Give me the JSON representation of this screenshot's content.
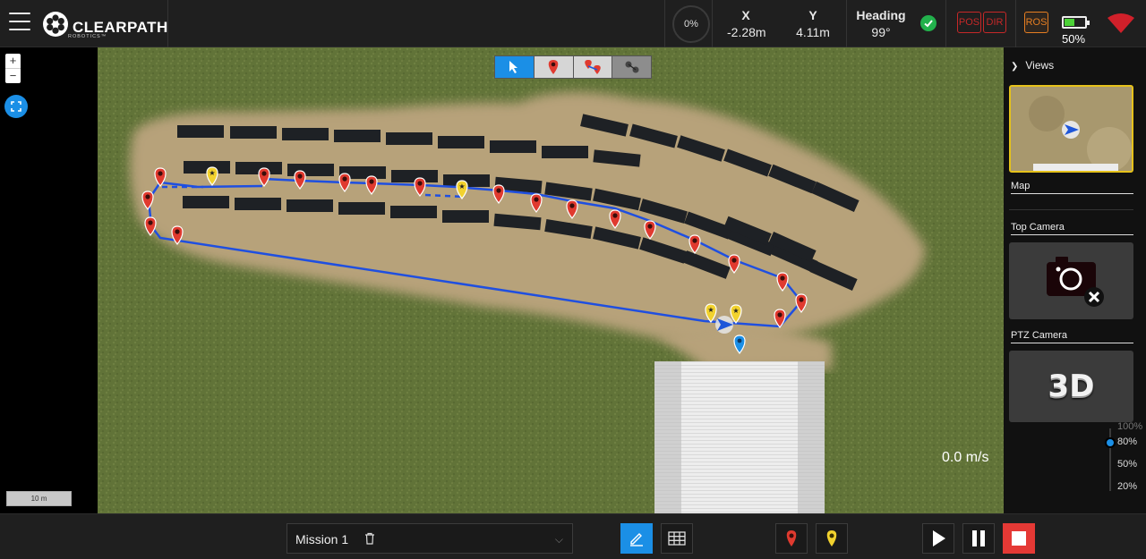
{
  "app": {
    "logo_text": "CLEARPATH",
    "logo_sub": "ROBOTICS™"
  },
  "status": {
    "progress_label": "0%",
    "x_label": "X",
    "x_value": "-2.28m",
    "y_label": "Y",
    "y_value": "4.11m",
    "heading_label": "Heading",
    "heading_value": "99°",
    "pos_badge": "POS",
    "dir_badge": "DIR",
    "ros_badge": "ROS",
    "battery_pct": "50%",
    "battery_level": 0.5,
    "colors": {
      "ok": "#22b14c",
      "error": "#c62828",
      "warn": "#e67e22",
      "accent": "#1b8fe6"
    }
  },
  "map": {
    "zoom_in": "+",
    "zoom_out": "−",
    "scale_label": "10 m",
    "speed": "0.0 m/s",
    "toolbar_icons": [
      "cursor-icon",
      "waypoint-icon",
      "route-icon",
      "cluster-icon"
    ]
  },
  "views": {
    "header": "Views",
    "items": [
      {
        "label": "Map"
      },
      {
        "label": "Top Camera"
      },
      {
        "label": "PTZ Camera",
        "thumb_text": "3D"
      }
    ]
  },
  "speed_slider": {
    "labels": [
      "100%",
      "80%",
      "50%",
      "20%"
    ],
    "selected": "80%"
  },
  "mission": {
    "name": "Mission 1"
  }
}
